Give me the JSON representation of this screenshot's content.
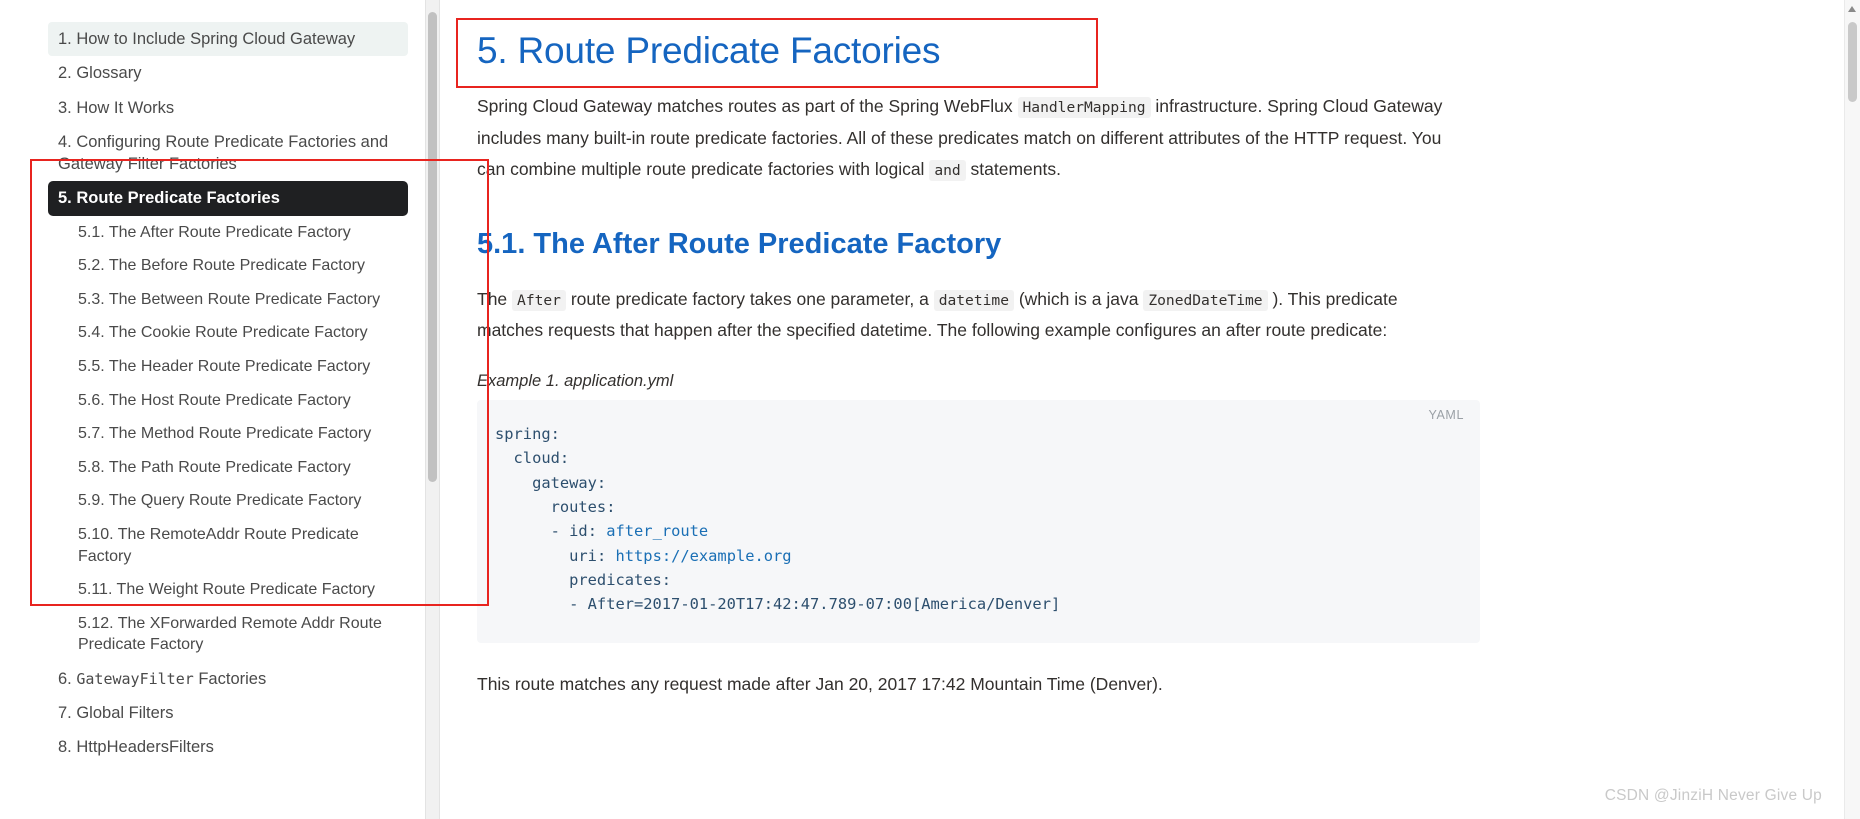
{
  "sidebar": {
    "items": [
      {
        "label": "1. How to Include Spring Cloud Gateway",
        "level": 1,
        "state": "hover"
      },
      {
        "label": "2. Glossary",
        "level": 1,
        "state": "normal"
      },
      {
        "label": "3. How It Works",
        "level": 1,
        "state": "normal"
      },
      {
        "label": "4. Configuring Route Predicate Factories and Gateway Filter Factories",
        "level": 1,
        "state": "normal"
      },
      {
        "label": "5. Route Predicate Factories",
        "level": 1,
        "state": "active"
      },
      {
        "label": "5.1. The After Route Predicate Factory",
        "level": 2,
        "state": "normal"
      },
      {
        "label": "5.2. The Before Route Predicate Factory",
        "level": 2,
        "state": "normal"
      },
      {
        "label": "5.3. The Between Route Predicate Factory",
        "level": 2,
        "state": "normal"
      },
      {
        "label": "5.4. The Cookie Route Predicate Factory",
        "level": 2,
        "state": "normal"
      },
      {
        "label": "5.5. The Header Route Predicate Factory",
        "level": 2,
        "state": "normal"
      },
      {
        "label": "5.6. The Host Route Predicate Factory",
        "level": 2,
        "state": "normal"
      },
      {
        "label": "5.7. The Method Route Predicate Factory",
        "level": 2,
        "state": "normal"
      },
      {
        "label": "5.8. The Path Route Predicate Factory",
        "level": 2,
        "state": "normal"
      },
      {
        "label": "5.9. The Query Route Predicate Factory",
        "level": 2,
        "state": "normal"
      },
      {
        "label": "5.10. The RemoteAddr Route Predicate Factory",
        "level": 2,
        "state": "normal"
      },
      {
        "label": "5.11. The Weight Route Predicate Factory",
        "level": 2,
        "state": "normal"
      },
      {
        "label": "5.12. The XForwarded Remote Addr Route Predicate Factory",
        "level": 2,
        "state": "normal"
      },
      {
        "label": "6. GatewayFilter Factories",
        "level": 1,
        "state": "normal",
        "mono_prefix": "GatewayFilter"
      },
      {
        "label": "7. Global Filters",
        "level": 1,
        "state": "normal"
      },
      {
        "label": "8. HttpHeadersFilters",
        "level": 1,
        "state": "normal"
      }
    ],
    "item6": {
      "number": "6. ",
      "mono": "GatewayFilter",
      "rest": " Factories"
    }
  },
  "main": {
    "h1": "5. Route Predicate Factories",
    "intro": {
      "part1": "Spring Cloud Gateway matches routes as part of the Spring WebFlux ",
      "code1": "HandlerMapping",
      "part2": " infrastructure. Spring Cloud Gateway includes many built-in route predicate factories. All of these predicates match on different attributes of the HTTP request. You can combine multiple route predicate factories with logical ",
      "code2": "and",
      "part3": " statements."
    },
    "h2": "5.1. The After Route Predicate Factory",
    "after_para": {
      "part1": "The ",
      "code1": "After",
      "part2": " route predicate factory takes one parameter, a ",
      "code2": "datetime",
      "part3": " (which is a java ",
      "code3": "ZonedDateTime",
      "part4": " ). This predicate matches requests that happen after the specified datetime. The following example configures an after route predicate:"
    },
    "example_caption": "Example 1. application.yml",
    "code_lang": "YAML",
    "code_lines": [
      "spring:",
      "  cloud:",
      "    gateway:",
      "      routes:",
      "      - id: after_route",
      "        uri: https://example.org",
      "        predicates:",
      "        - After=2017-01-20T17:42:47.789-07:00[America/Denver]"
    ],
    "closing_para": "This route matches any request made after Jan 20, 2017 17:42 Mountain Time (Denver)."
  },
  "watermark": "CSDN @JinziH Never Give Up",
  "colors": {
    "heading_blue": "#1565c0",
    "active_bg": "#1f2022",
    "annotation_red": "#e8241f",
    "code_bg": "#f6f7f9",
    "code_text": "#2d4f6e",
    "hover_bg": "#eef3f2"
  }
}
